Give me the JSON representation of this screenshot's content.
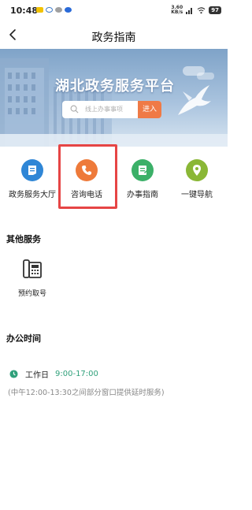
{
  "status_bar": {
    "time": "10:48",
    "net_speed_value": "3.60",
    "net_speed_unit": "KB/s",
    "battery": "97"
  },
  "nav": {
    "title": "政务指南"
  },
  "banner": {
    "title": "湖北政务服务平台",
    "search_placeholder": "线上办事事项",
    "search_button": "进入"
  },
  "services": [
    {
      "label": "政务服务大厅",
      "icon": "document-icon",
      "color": "#2f86d6"
    },
    {
      "label": "咨询电话",
      "icon": "phone-icon",
      "color": "#ee7a3a"
    },
    {
      "label": "办事指南",
      "icon": "guide-icon",
      "color": "#3bb068"
    },
    {
      "label": "一键导航",
      "icon": "location-pin-icon",
      "color": "#8ab736"
    }
  ],
  "other_services": {
    "title": "其他服务",
    "items": [
      {
        "label": "预约取号",
        "icon": "telephone-keypad-icon"
      }
    ]
  },
  "office_hours": {
    "title": "办公时间",
    "day_label": "工作日",
    "time_range": "9:00-17:00",
    "note": "(中午12:00-13:30之间部分窗口提供延时服务)",
    "accent": "#2fa07a"
  },
  "highlight_color": "#e64545"
}
